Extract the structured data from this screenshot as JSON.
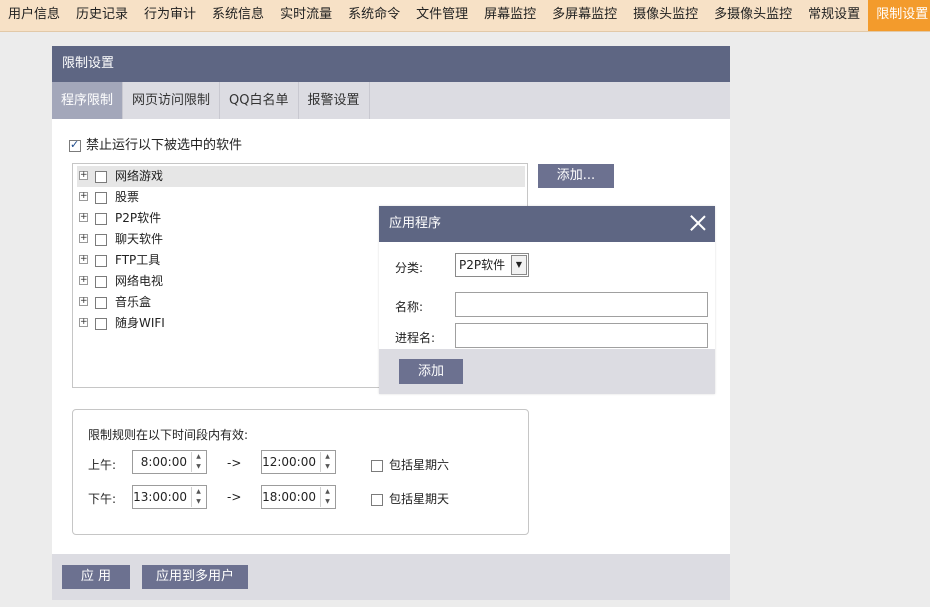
{
  "nav": {
    "items": [
      "用户信息",
      "历史记录",
      "行为审计",
      "系统信息",
      "实时流量",
      "系统命令",
      "文件管理",
      "屏幕监控",
      "多屏幕监控",
      "摄像头监控",
      "多摄像头监控",
      "常规设置",
      "限制设置"
    ],
    "active_index": 12
  },
  "panel": {
    "title": "限制设置",
    "tabs": [
      "程序限制",
      "网页访问限制",
      "QQ白名单",
      "报警设置"
    ],
    "active_tab": 0,
    "forbid_label": "禁止运行以下被选中的软件",
    "forbid_checked": true,
    "categories": [
      "网络游戏",
      "股票",
      "P2P软件",
      "聊天软件",
      "FTP工具",
      "网络电视",
      "音乐盒",
      "随身WIFI"
    ],
    "selected_category": 0,
    "add_button": "添加...",
    "time": {
      "title": "限制规则在以下时间段内有效:",
      "am_label": "上午:",
      "pm_label": "下午:",
      "am_start": "8:00:00",
      "am_end": "12:00:00",
      "pm_start": "13:00:00",
      "pm_end": "18:00:00",
      "separator": "->",
      "saturday_label": "包括星期六",
      "sunday_label": "包括星期天"
    },
    "apply_button": "应 用",
    "apply_multi_button": "应用到多用户"
  },
  "dialog": {
    "title": "应用程序",
    "category_label": "分类:",
    "category_value": "P2P软件",
    "name_label": "名称:",
    "name_value": "",
    "process_label": "进程名:",
    "process_value": "",
    "add_button": "添加"
  }
}
